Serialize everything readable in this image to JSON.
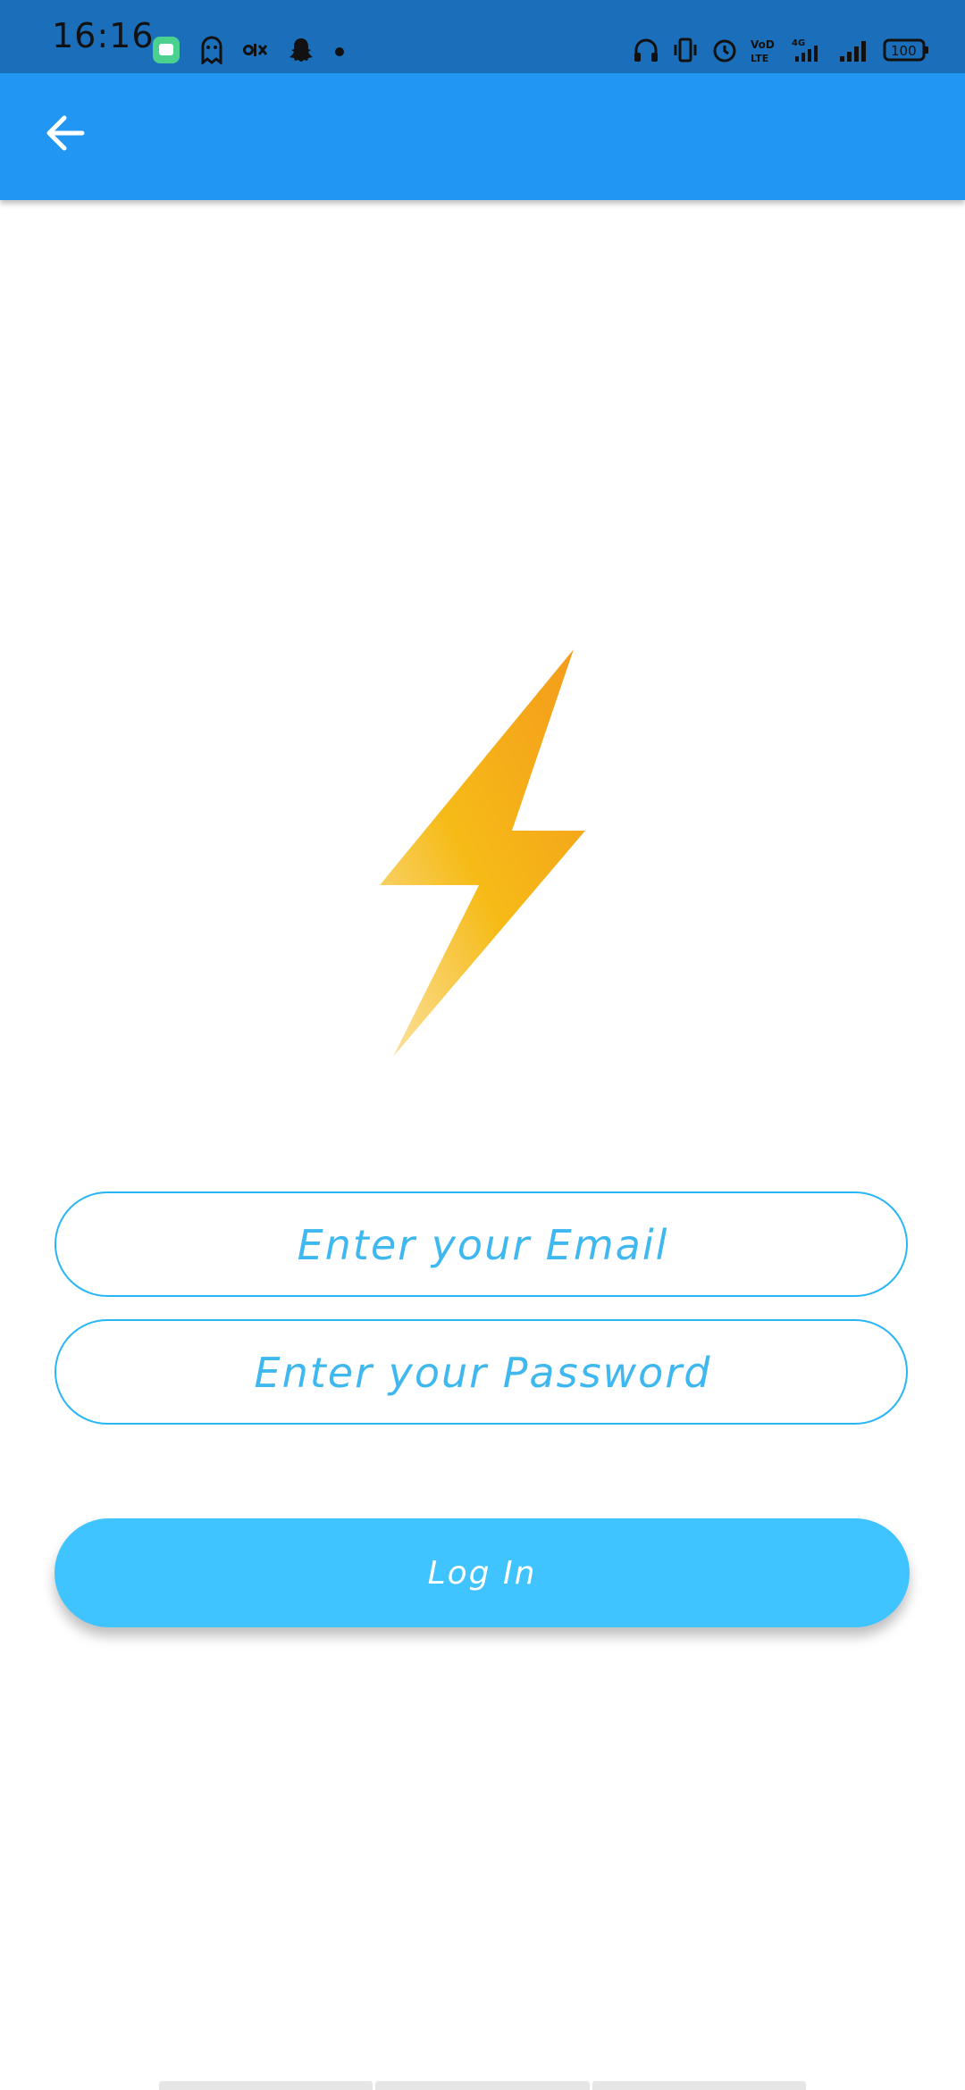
{
  "status_bar": {
    "time": "16:16",
    "battery": "100",
    "left_icons": [
      "messages-icon",
      "ghost-icon",
      "olx-icon",
      "snapchat-icon",
      "dot-icon"
    ],
    "right_icons": [
      "headphones-icon",
      "vibrate-icon",
      "alarm-icon",
      "volte-icon",
      "signal-4g-icon",
      "signal-icon",
      "battery-icon"
    ]
  },
  "app_bar": {
    "back_icon": "arrow-back-icon",
    "color": "#2196f3"
  },
  "logo": {
    "icon": "lightning-bolt-icon"
  },
  "form": {
    "email_placeholder": "Enter your Email",
    "password_placeholder": "Enter your Password",
    "login_label": "Log In",
    "accent_color": "#29b6f6",
    "button_color": "#40c4ff"
  }
}
